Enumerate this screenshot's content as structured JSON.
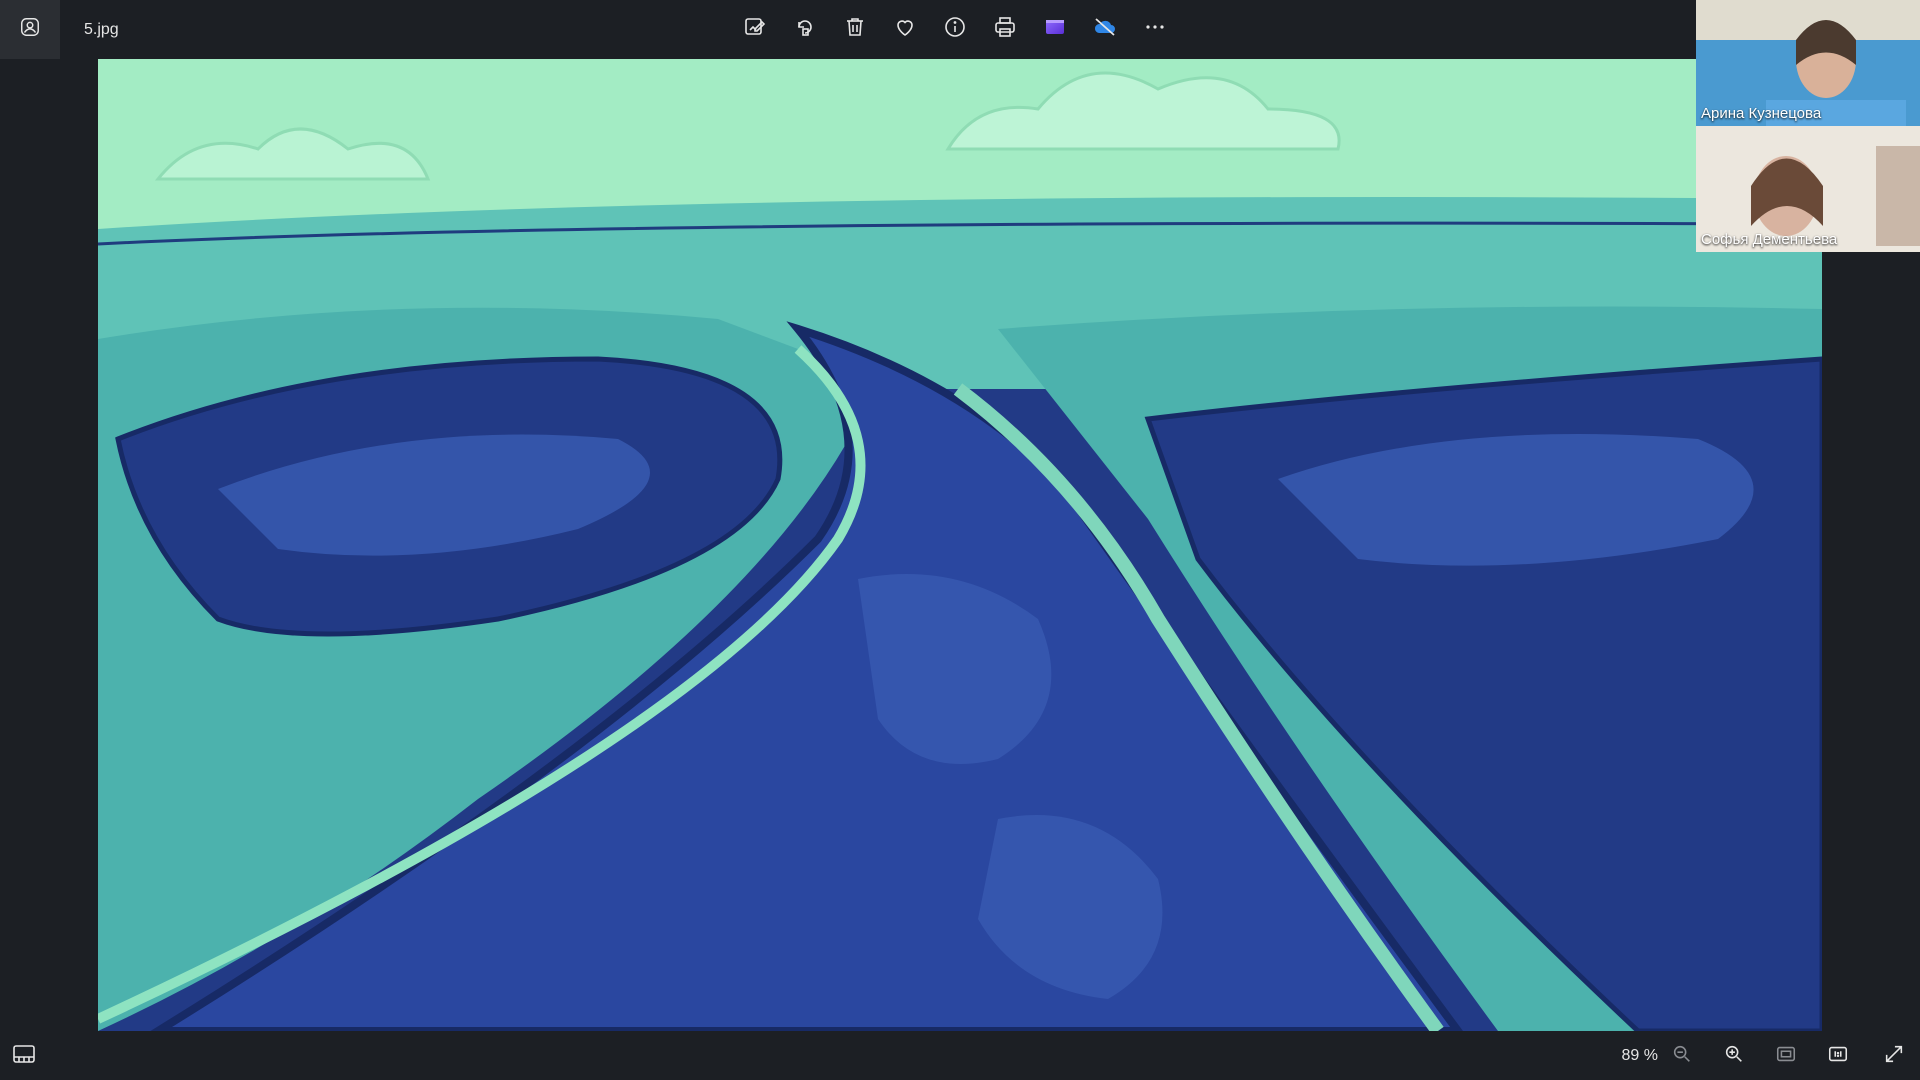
{
  "file": {
    "name": "5.jpg"
  },
  "toolbar": {
    "items": [
      {
        "name": "edit-image-icon"
      },
      {
        "name": "rotate-icon"
      },
      {
        "name": "delete-icon"
      },
      {
        "name": "favorite-heart-icon"
      },
      {
        "name": "info-icon"
      },
      {
        "name": "print-icon"
      },
      {
        "name": "clipchamp-icon"
      },
      {
        "name": "onedrive-off-icon"
      },
      {
        "name": "more-options-icon"
      }
    ]
  },
  "participants": [
    {
      "name": "Арина Кузнецова"
    },
    {
      "name": "Софья Дементьева"
    }
  ],
  "status": {
    "zoom": "89 %"
  },
  "colors": {
    "background": "#1c1f24",
    "sky": "#a3ecc4",
    "river_dark": "#223a86",
    "land_teal": "#3fa3a6"
  }
}
